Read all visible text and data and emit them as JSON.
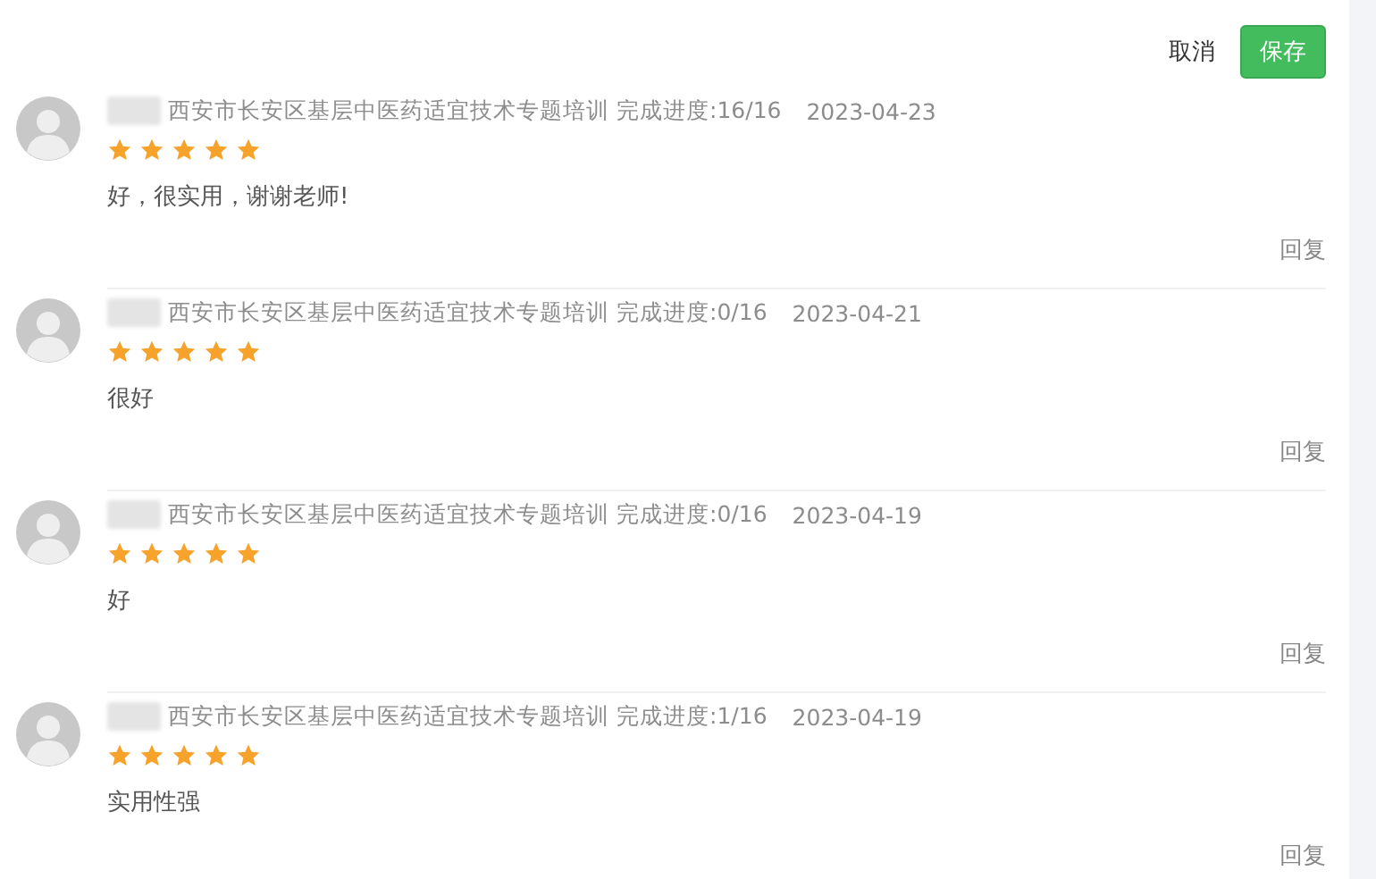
{
  "actions": {
    "cancel": "取消",
    "save": "保存"
  },
  "reviews": [
    {
      "course": "西安市长安区基层中医药适宜技术专题培训",
      "progress": "完成进度:16/16",
      "date": "2023-04-23",
      "stars": 5,
      "comment": "好，很实用，谢谢老师!",
      "reply": "回复"
    },
    {
      "course": "西安市长安区基层中医药适宜技术专题培训",
      "progress": "完成进度:0/16",
      "date": "2023-04-21",
      "stars": 5,
      "comment": "很好",
      "reply": "回复"
    },
    {
      "course": "西安市长安区基层中医药适宜技术专题培训",
      "progress": "完成进度:0/16",
      "date": "2023-04-19",
      "stars": 5,
      "comment": "好",
      "reply": "回复"
    },
    {
      "course": "西安市长安区基层中医药适宜技术专题培训",
      "progress": "完成进度:1/16",
      "date": "2023-04-19",
      "stars": 5,
      "comment": "实用性强",
      "reply": "回复"
    }
  ]
}
